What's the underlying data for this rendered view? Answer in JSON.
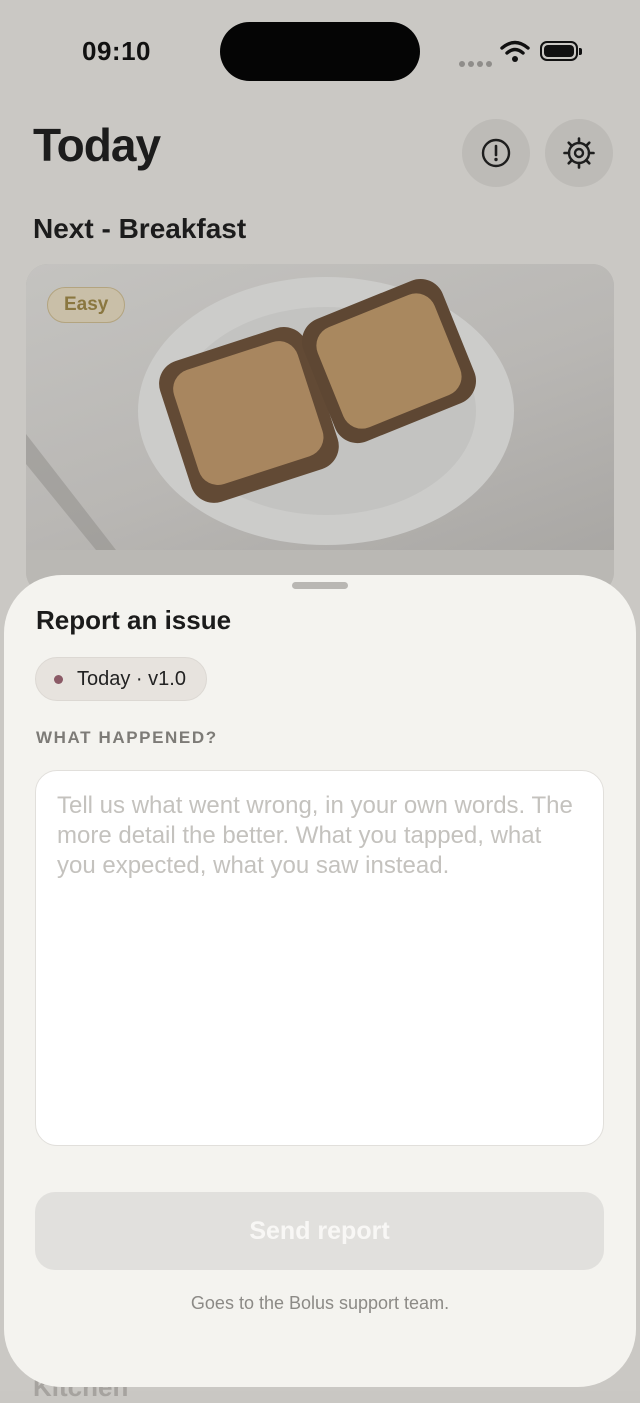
{
  "status_bar": {
    "time": "09:10"
  },
  "screen": {
    "title": "Today",
    "next_section": "Next - Breakfast",
    "card_badge": "Easy",
    "partial_section": "Kitchen"
  },
  "icons": {
    "alert": "alert-circle-icon",
    "settings": "gear-icon",
    "wifi": "wifi-icon",
    "battery": "battery-icon"
  },
  "sheet": {
    "title": "Report an issue",
    "context_chip": "Today · v1.0",
    "field_label": "WHAT HAPPENED?",
    "field_placeholder": "Tell us what went wrong, in your own words. The more detail the better. What you tapped, what you expected, what you saw instead.",
    "field_value": "",
    "send_label": "Send report",
    "send_enabled": false,
    "footnote": "Goes to the Bolus support team."
  },
  "colors": {
    "badge_text": "#8a7740",
    "chip_dot": "#8b5a66",
    "sheet_bg": "#f4f3ef",
    "button_disabled": "#e1e0dd"
  }
}
